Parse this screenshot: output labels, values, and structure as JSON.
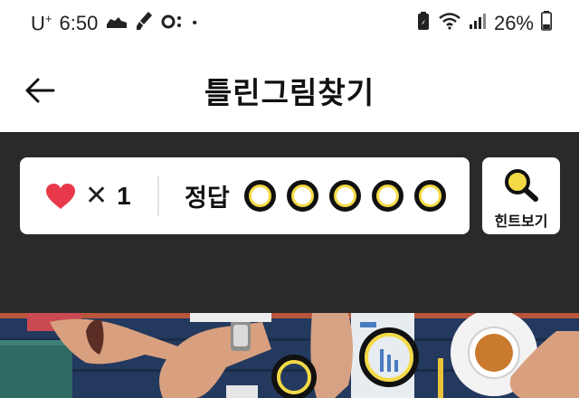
{
  "status_bar": {
    "carrier": "U",
    "carrier_sup": "+",
    "time": "6:50",
    "dot": "•",
    "battery_percent": "26%"
  },
  "app_bar": {
    "title": "틀린그림찾기",
    "back_icon": "arrow-left-icon"
  },
  "score": {
    "lives_icon": "heart-icon",
    "times": "✕",
    "lives": "1",
    "answer_label": "정답",
    "answers_total": 5,
    "answers_found": 0
  },
  "hint": {
    "label": "힌트보기",
    "icon": "magnifier-icon"
  },
  "colors": {
    "accent_yellow": "#f3da45",
    "heart_red": "#e8394a",
    "game_bg": "#2a2a2a"
  }
}
